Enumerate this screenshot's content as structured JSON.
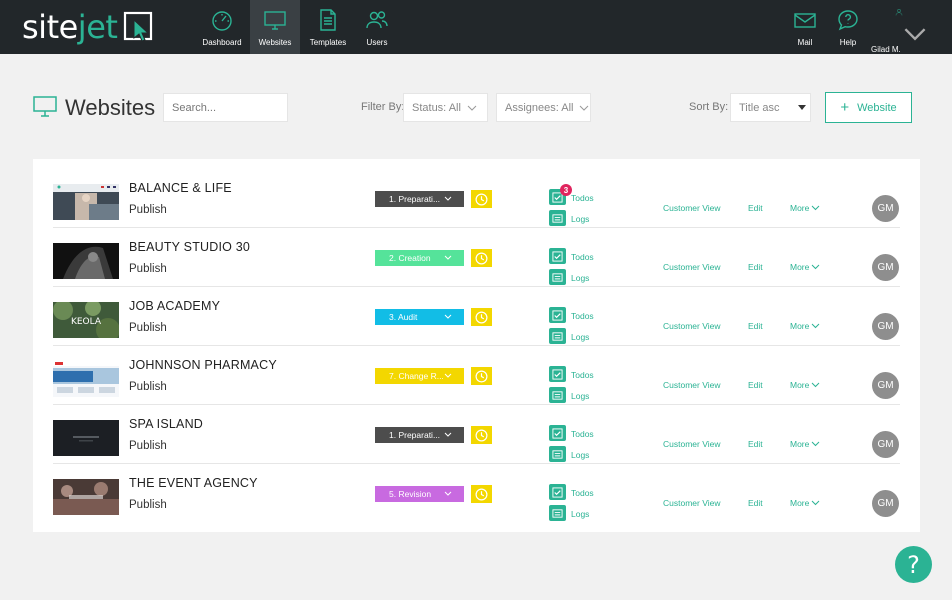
{
  "app": {
    "logo_a": "site",
    "logo_b": "jet"
  },
  "nav": {
    "left": [
      {
        "label": "Dashboard",
        "icon": "gauge-icon"
      },
      {
        "label": "Websites",
        "icon": "monitor-icon",
        "active": true
      },
      {
        "label": "Templates",
        "icon": "document-icon"
      },
      {
        "label": "Users",
        "icon": "users-icon"
      }
    ],
    "right": [
      {
        "label": "Mail",
        "icon": "mail-icon"
      },
      {
        "label": "Help",
        "icon": "help-bubble-icon"
      },
      {
        "label": "Gilad M.",
        "icon": "user-icon"
      }
    ]
  },
  "page": {
    "title": "Websites",
    "search_placeholder": "Search...",
    "filter_label": "Filter By:",
    "status_filter": "Status: All",
    "assignees_filter": "Assignees: All",
    "sort_label": "Sort By:",
    "sort_value": "Title asc",
    "add_button": "Website"
  },
  "row_labels": {
    "todos": "Todos",
    "logs": "Logs",
    "customer_view": "Customer View",
    "edit": "Edit",
    "more": "More"
  },
  "websites": [
    {
      "name": "BALANCE & LIFE",
      "status": "Publish",
      "stage": "1. Preparati...",
      "stage_color": "#4d4d4d",
      "todo_count": "3",
      "assignee": "GM"
    },
    {
      "name": "BEAUTY STUDIO 30",
      "status": "Publish",
      "stage": "2. Creation",
      "stage_color": "#55e39a",
      "todo_count": "",
      "assignee": "GM"
    },
    {
      "name": "JOB ACADEMY",
      "status": "Publish",
      "stage": "3. Audit",
      "stage_color": "#12bde6",
      "todo_count": "",
      "assignee": "GM"
    },
    {
      "name": "JOHNNSON PHARMACY",
      "status": "Publish",
      "stage": "7. Change R...",
      "stage_color": "#f3d700",
      "todo_count": "",
      "assignee": "GM"
    },
    {
      "name": "SPA ISLAND",
      "status": "Publish",
      "stage": "1. Preparati...",
      "stage_color": "#4d4d4d",
      "todo_count": "",
      "assignee": "GM"
    },
    {
      "name": "THE EVENT AGENCY",
      "status": "Publish",
      "stage": "5. Revision",
      "stage_color": "#c86ae0",
      "todo_count": "",
      "assignee": "GM"
    }
  ],
  "thumb_labels": {
    "job_academy": "KEOLA"
  },
  "help_button": "?",
  "colors": {
    "brand": "#2bb394",
    "topbar": "#22272a",
    "badge": "#e0245e",
    "clock": "#f3d700"
  }
}
